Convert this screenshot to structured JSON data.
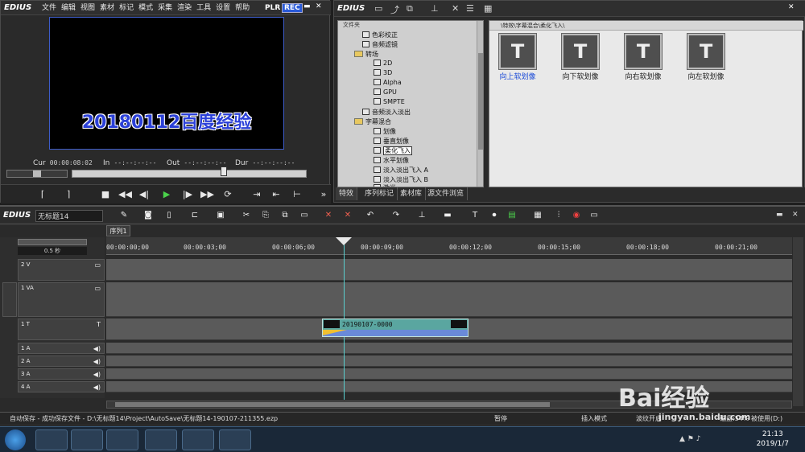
{
  "player": {
    "logo": "EDIUS",
    "menu": [
      "文件",
      "编辑",
      "视图",
      "素材",
      "标记",
      "模式",
      "采集",
      "渲染",
      "工具",
      "设置",
      "帮助"
    ],
    "mode_plr": "PLR",
    "mode_rec": "REC",
    "overlay_text": "20180112百度经验",
    "tc": {
      "cur_label": "Cur",
      "cur": "00:00:08:02",
      "in_label": "In",
      "in": "--:--:--:--",
      "out_label": "Out",
      "out": "--:--:--:--",
      "dur_label": "Dur",
      "dur": "--:--:--:--"
    }
  },
  "effects": {
    "logo": "EDIUS",
    "folder_header": "文件夹",
    "path": "\\特效\\字幕混合\\柔化飞入\\",
    "tree": [
      {
        "label": "色彩校正",
        "kind": "item"
      },
      {
        "label": "音频滤镜",
        "kind": "item"
      },
      {
        "label": "转场",
        "kind": "folder"
      },
      {
        "label": "2D",
        "kind": "item"
      },
      {
        "label": "3D",
        "kind": "item"
      },
      {
        "label": "Alpha",
        "kind": "item"
      },
      {
        "label": "GPU",
        "kind": "item"
      },
      {
        "label": "SMPTE",
        "kind": "item"
      },
      {
        "label": "音频淡入淡出",
        "kind": "item"
      },
      {
        "label": "字幕混合",
        "kind": "folder"
      },
      {
        "label": "划像",
        "kind": "item"
      },
      {
        "label": "垂直划像",
        "kind": "item"
      },
      {
        "label": "柔化飞入",
        "kind": "item"
      },
      {
        "label": "水平划像",
        "kind": "item"
      },
      {
        "label": "淡入淡出飞入 A",
        "kind": "item"
      },
      {
        "label": "淡入淡出飞入 B",
        "kind": "item"
      },
      {
        "label": "激光",
        "kind": "item"
      }
    ],
    "tiles": [
      {
        "label": "向上软划像",
        "arrow": "▲"
      },
      {
        "label": "向下软划像",
        "arrow": "▼"
      },
      {
        "label": "向右软划像",
        "arrow": "▶"
      },
      {
        "label": "向左软划像",
        "arrow": "◀"
      }
    ],
    "tabs": [
      "特效",
      "序列标记",
      "素材库",
      "源文件浏览"
    ]
  },
  "timeline": {
    "logo": "EDIUS",
    "project_name": "无标题14",
    "sequence_tab": "序列1",
    "zoom": "0.5 秒",
    "ruler": [
      "00:00:00;00",
      "00:00:03;00",
      "00:00:06;00",
      "00:00:09;00",
      "00:00:12;00",
      "00:00:15;00",
      "00:00:18;00",
      "00:00:21;00"
    ],
    "tracks": [
      "2 V",
      "1 VA",
      "1 T",
      "1 A",
      "2 A",
      "3 A",
      "4 A"
    ],
    "clip_name": "20190107-0000"
  },
  "status": {
    "autosave": "自动保存 - 成功保存文件 - D:\\无标题14\\Project\\AutoSave\\无标题14-190107-211355.ezp",
    "pause": "暂停",
    "insert_mode": "插入模式",
    "ripple": "波纹开启",
    "disk": "磁盘:54% 被使用(D:)"
  },
  "taskbar": {
    "time": "21:13",
    "date": "2019/1/7"
  },
  "watermark": {
    "text": "Bai经验",
    "url": "jingyan.baidu.com"
  }
}
